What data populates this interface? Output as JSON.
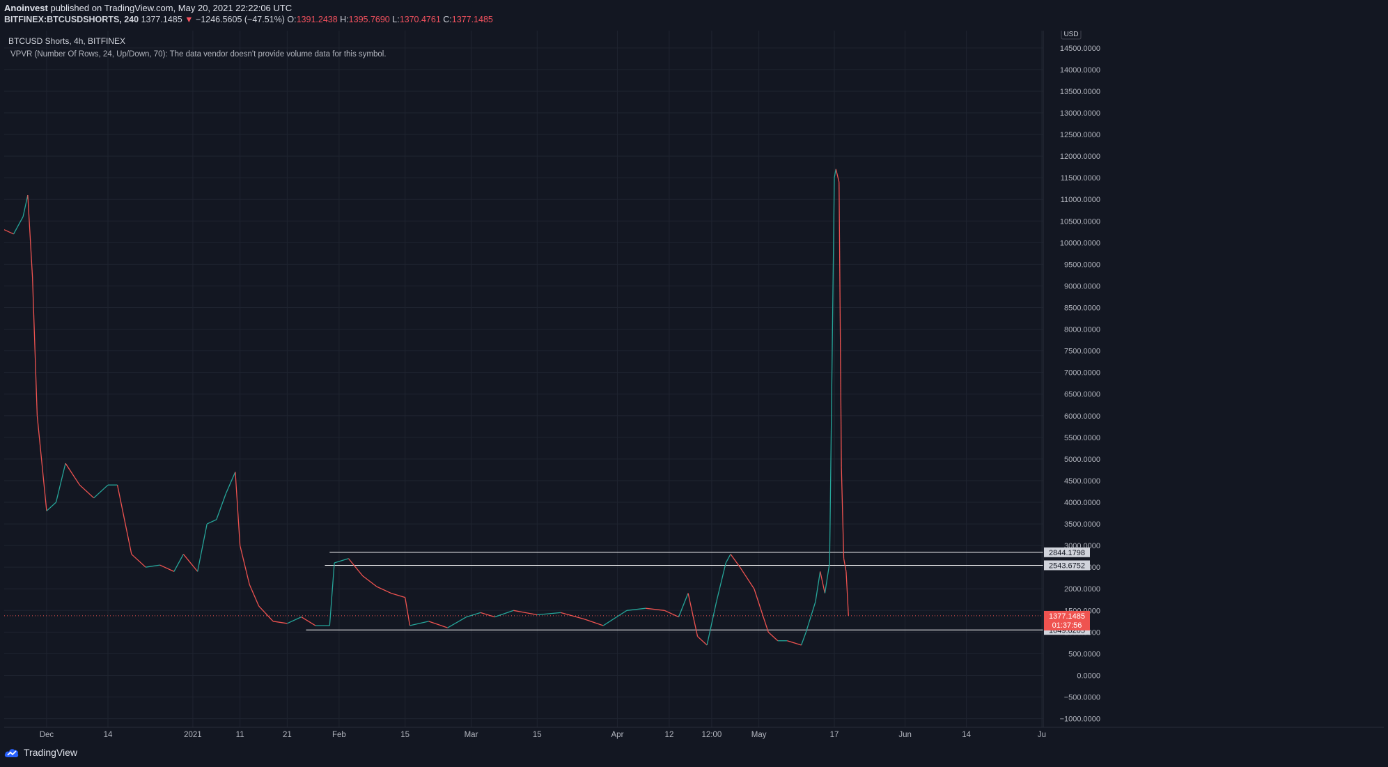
{
  "header": {
    "author": "Anoinvest",
    "published_text": "published on TradingView.com, May 20, 2021 22:22:06 UTC",
    "symbol": "BITFINEX:BTCUSDSHORTS, 240",
    "last": "1377.1485",
    "change_arrow": "▼",
    "change": "−1246.5605 (−47.51%)",
    "o_label": "O:",
    "o_value": "1391.2438",
    "h_label": "H:",
    "h_value": "1395.7690",
    "l_label": "L:",
    "l_value": "1370.4761",
    "c_label": "C:",
    "c_value": "1377.1485"
  },
  "legend": {
    "title": "BTCUSD Shorts, 4h, BITFINEX",
    "indicator": "VPVR (Number Of Rows, 24, Up/Down, 70): The data vendor doesn't provide volume data for this symbol."
  },
  "footer": {
    "brand": "TradingView"
  },
  "colors": {
    "up": "#26a69a",
    "down": "#ef5350",
    "bg": "#131722",
    "grid": "#1f2430",
    "text": "#b2b5be",
    "hline": "#ffffff"
  },
  "chart_data": {
    "type": "line",
    "title": "BTCUSD Shorts, 4h, BITFINEX",
    "currency": "USD",
    "xlabel": "",
    "ylabel": "",
    "ylim": [
      -1200,
      14900
    ],
    "xlim": [
      "2020-11-22",
      "2021-06-30"
    ],
    "grid": true,
    "y_ticks": [
      -1000,
      -500,
      0,
      500,
      1000,
      1500,
      2000,
      2500,
      3000,
      3500,
      4000,
      4500,
      5000,
      5500,
      6000,
      6500,
      7000,
      7500,
      8000,
      8500,
      9000,
      9500,
      10000,
      10500,
      11000,
      11500,
      12000,
      12500,
      13000,
      13500,
      14000,
      14500
    ],
    "x_ticks": [
      {
        "date": "2020-12-01",
        "label": "Dec"
      },
      {
        "date": "2020-12-14",
        "label": "14"
      },
      {
        "date": "2021-01-01",
        "label": "2021"
      },
      {
        "date": "2021-01-11",
        "label": "11"
      },
      {
        "date": "2021-01-21",
        "label": "21"
      },
      {
        "date": "2021-02-01",
        "label": "Feb"
      },
      {
        "date": "2021-02-15",
        "label": "15"
      },
      {
        "date": "2021-03-01",
        "label": "Mar"
      },
      {
        "date": "2021-03-15",
        "label": "15"
      },
      {
        "date": "2021-04-01",
        "label": "Apr"
      },
      {
        "date": "2021-04-12",
        "label": "12"
      },
      {
        "date": "2021-04-21",
        "label": "12:00"
      },
      {
        "date": "2021-05-01",
        "label": "May"
      },
      {
        "date": "2021-05-17",
        "label": "17"
      },
      {
        "date": "2021-06-01",
        "label": "Jun"
      },
      {
        "date": "2021-06-14",
        "label": "14"
      },
      {
        "date": "2021-06-30",
        "label": "Ju"
      }
    ],
    "series": [
      {
        "x": [
          "2020-11-22",
          "2020-11-24",
          "2020-11-26",
          "2020-11-27",
          "2020-11-28",
          "2020-11-29",
          "2020-12-01",
          "2020-12-03",
          "2020-12-05",
          "2020-12-08",
          "2020-12-11",
          "2020-12-14",
          "2020-12-16",
          "2020-12-19",
          "2020-12-22",
          "2020-12-25",
          "2020-12-28",
          "2020-12-30",
          "2021-01-02",
          "2021-01-04",
          "2021-01-06",
          "2021-01-08",
          "2021-01-10",
          "2021-01-11",
          "2021-01-13",
          "2021-01-15",
          "2021-01-18",
          "2021-01-21",
          "2021-01-24",
          "2021-01-27",
          "2021-01-30",
          "2021-01-31",
          "2021-02-03",
          "2021-02-06",
          "2021-02-09",
          "2021-02-12",
          "2021-02-15",
          "2021-02-16",
          "2021-02-20",
          "2021-02-24",
          "2021-02-28",
          "2021-03-03",
          "2021-03-06",
          "2021-03-10",
          "2021-03-15",
          "2021-03-20",
          "2021-03-25",
          "2021-03-29",
          "2021-04-03",
          "2021-04-07",
          "2021-04-11",
          "2021-04-14",
          "2021-04-16",
          "2021-04-18",
          "2021-04-20",
          "2021-04-22",
          "2021-04-24",
          "2021-04-25",
          "2021-04-27",
          "2021-04-30",
          "2021-05-03",
          "2021-05-05",
          "2021-05-07",
          "2021-05-10",
          "2021-05-11",
          "2021-05-13",
          "2021-05-14",
          "2021-05-15",
          "2021-05-16",
          "2021-05-17",
          "2021-05-17 08:00",
          "2021-05-18",
          "2021-05-18 12:00",
          "2021-05-19",
          "2021-05-19 12:00",
          "2021-05-20"
        ],
        "close": [
          10300,
          10200,
          10600,
          11100,
          9200,
          6000,
          3800,
          4000,
          4900,
          4400,
          4100,
          4400,
          4400,
          2800,
          2500,
          2550,
          2400,
          2800,
          2400,
          3500,
          3600,
          4200,
          4700,
          3000,
          2100,
          1600,
          1250,
          1200,
          1350,
          1150,
          1150,
          2600,
          2700,
          2300,
          2050,
          1900,
          1800,
          1150,
          1250,
          1100,
          1350,
          1450,
          1350,
          1500,
          1400,
          1450,
          1300,
          1150,
          1500,
          1550,
          1500,
          1350,
          1900,
          900,
          700,
          1700,
          2600,
          2800,
          2500,
          2000,
          1000,
          800,
          800,
          700,
          1000,
          1700,
          2400,
          1900,
          2600,
          11500,
          11700,
          11400,
          4800,
          2700,
          2400,
          1377
        ]
      }
    ],
    "horizontal_lines": [
      2844.1798,
      2543.6752,
      1049.6205
    ],
    "last_price": 1377.1485,
    "countdown": "01:37:56",
    "price_labels": [
      "2844.1798",
      "2543.6752",
      "1049.6205",
      "1377.1485"
    ]
  }
}
